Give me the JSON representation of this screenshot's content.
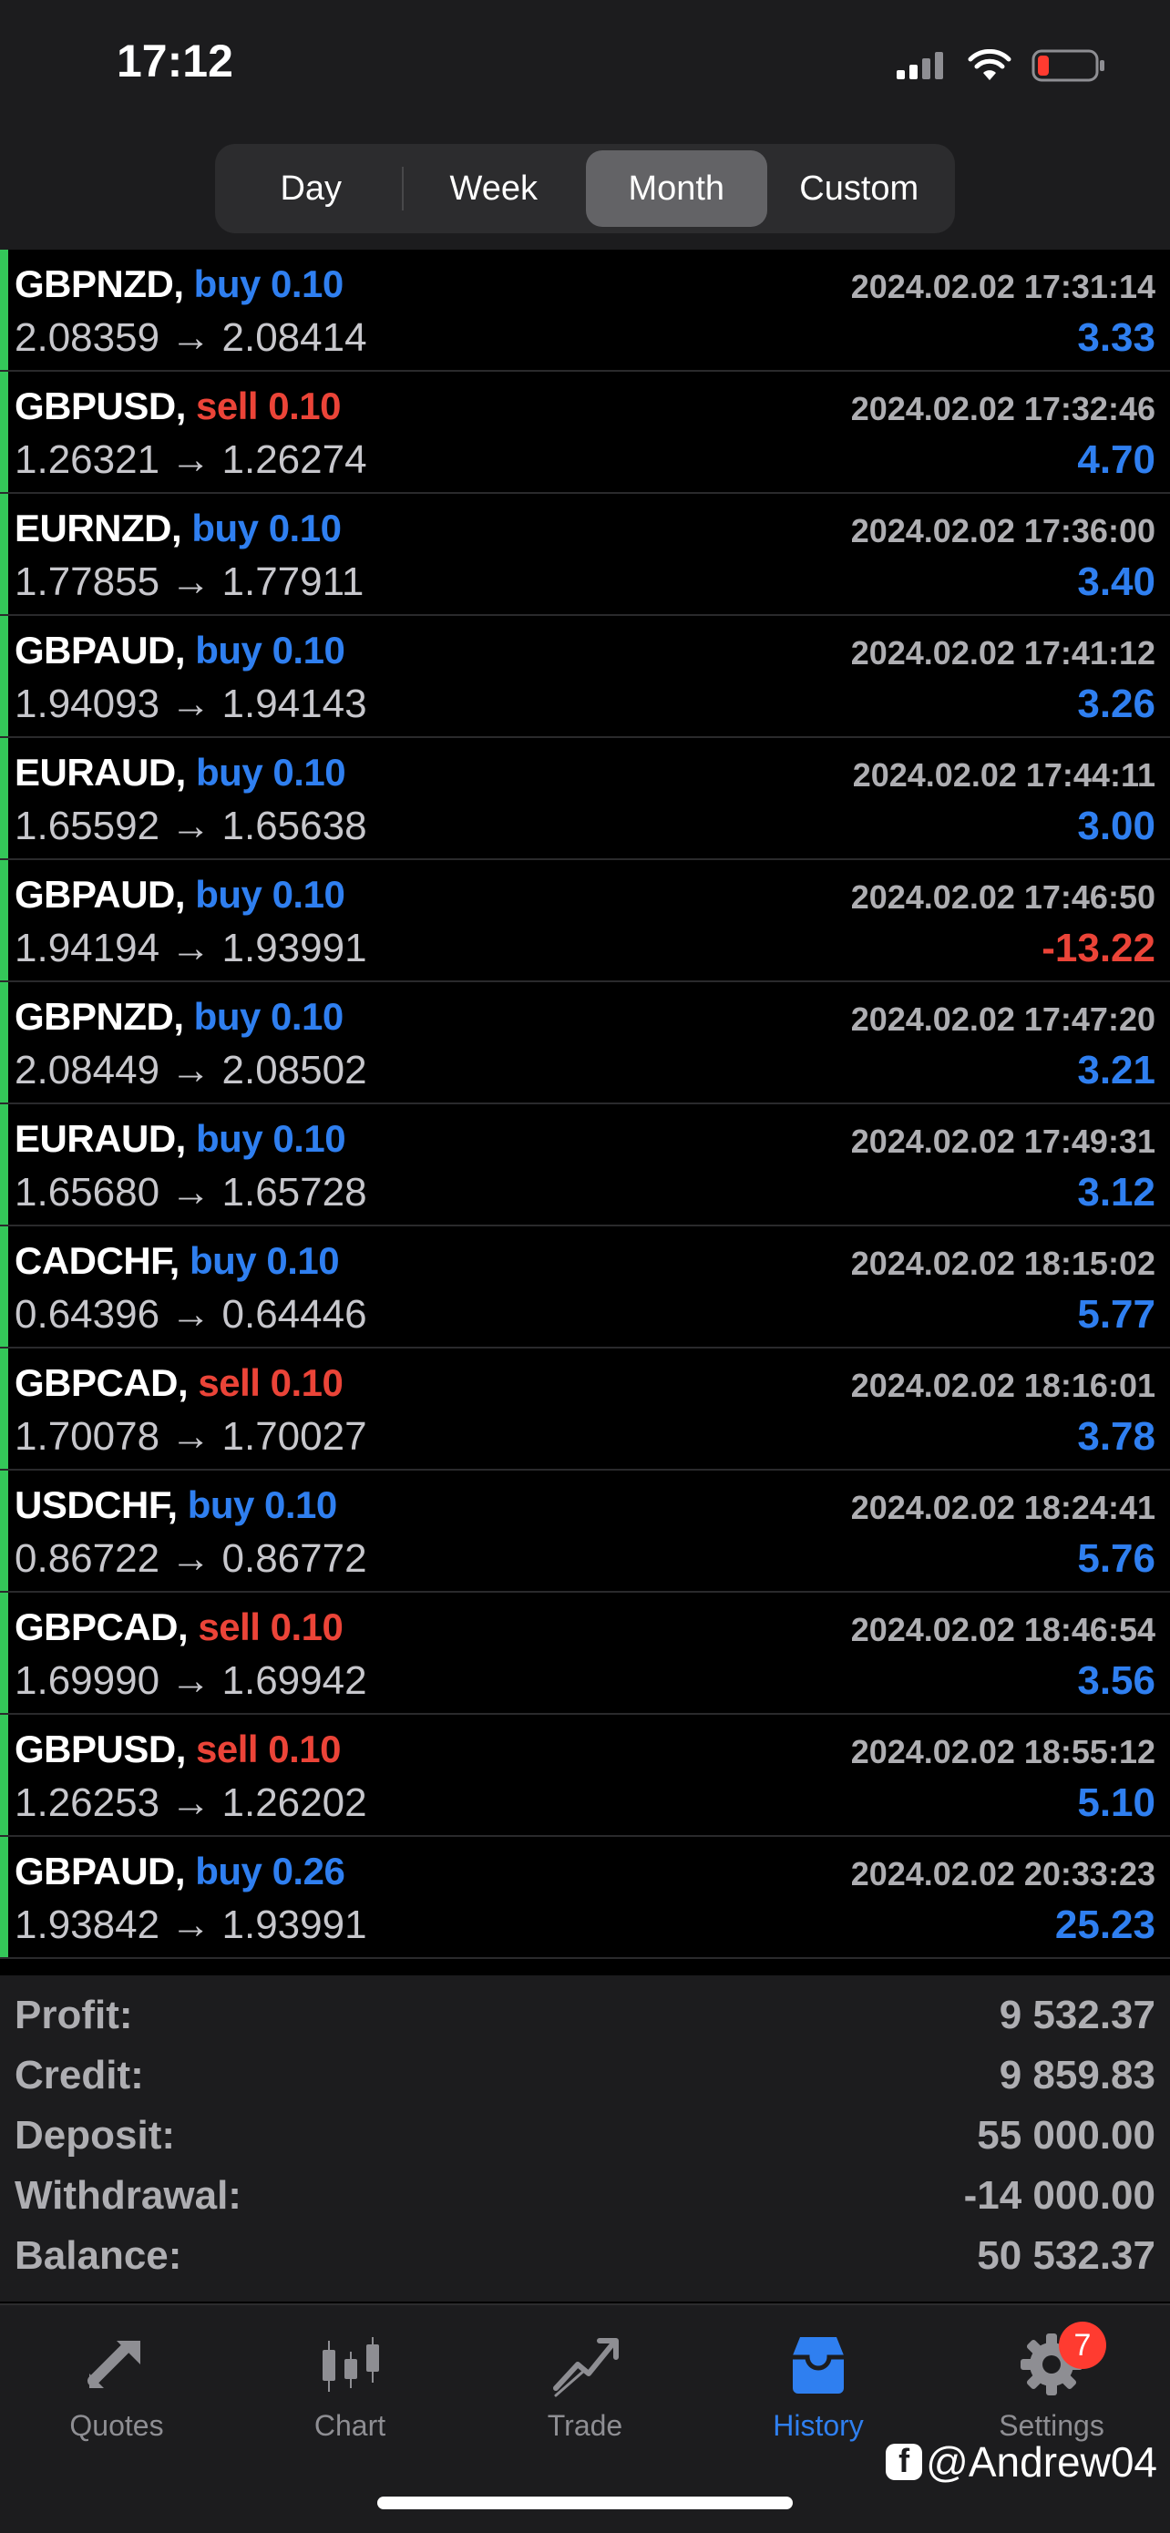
{
  "status": {
    "time": "17:12"
  },
  "period_tabs": [
    "Day",
    "Week",
    "Month",
    "Custom"
  ],
  "active_period": "Month",
  "trades": [
    {
      "symbol": "GBPNZD,",
      "side": "buy",
      "volume": "0.10",
      "open": "2.08359",
      "close": "2.08414",
      "time": "2024.02.02 17:31:14",
      "profit": "3.33"
    },
    {
      "symbol": "GBPUSD,",
      "side": "sell",
      "volume": "0.10",
      "open": "1.26321",
      "close": "1.26274",
      "time": "2024.02.02 17:32:46",
      "profit": "4.70"
    },
    {
      "symbol": "EURNZD,",
      "side": "buy",
      "volume": "0.10",
      "open": "1.77855",
      "close": "1.77911",
      "time": "2024.02.02 17:36:00",
      "profit": "3.40"
    },
    {
      "symbol": "GBPAUD,",
      "side": "buy",
      "volume": "0.10",
      "open": "1.94093",
      "close": "1.94143",
      "time": "2024.02.02 17:41:12",
      "profit": "3.26"
    },
    {
      "symbol": "EURAUD,",
      "side": "buy",
      "volume": "0.10",
      "open": "1.65592",
      "close": "1.65638",
      "time": "2024.02.02 17:44:11",
      "profit": "3.00"
    },
    {
      "symbol": "GBPAUD,",
      "side": "buy",
      "volume": "0.10",
      "open": "1.94194",
      "close": "1.93991",
      "time": "2024.02.02 17:46:50",
      "profit": "-13.22"
    },
    {
      "symbol": "GBPNZD,",
      "side": "buy",
      "volume": "0.10",
      "open": "2.08449",
      "close": "2.08502",
      "time": "2024.02.02 17:47:20",
      "profit": "3.21"
    },
    {
      "symbol": "EURAUD,",
      "side": "buy",
      "volume": "0.10",
      "open": "1.65680",
      "close": "1.65728",
      "time": "2024.02.02 17:49:31",
      "profit": "3.12"
    },
    {
      "symbol": "CADCHF,",
      "side": "buy",
      "volume": "0.10",
      "open": "0.64396",
      "close": "0.64446",
      "time": "2024.02.02 18:15:02",
      "profit": "5.77"
    },
    {
      "symbol": "GBPCAD,",
      "side": "sell",
      "volume": "0.10",
      "open": "1.70078",
      "close": "1.70027",
      "time": "2024.02.02 18:16:01",
      "profit": "3.78"
    },
    {
      "symbol": "USDCHF,",
      "side": "buy",
      "volume": "0.10",
      "open": "0.86722",
      "close": "0.86772",
      "time": "2024.02.02 18:24:41",
      "profit": "5.76"
    },
    {
      "symbol": "GBPCAD,",
      "side": "sell",
      "volume": "0.10",
      "open": "1.69990",
      "close": "1.69942",
      "time": "2024.02.02 18:46:54",
      "profit": "3.56"
    },
    {
      "symbol": "GBPUSD,",
      "side": "sell",
      "volume": "0.10",
      "open": "1.26253",
      "close": "1.26202",
      "time": "2024.02.02 18:55:12",
      "profit": "5.10"
    },
    {
      "symbol": "GBPAUD,",
      "side": "buy",
      "volume": "0.26",
      "open": "1.93842",
      "close": "1.93991",
      "time": "2024.02.02 20:33:23",
      "profit": "25.23"
    }
  ],
  "summary": [
    {
      "label": "Profit:",
      "value": "9 532.37"
    },
    {
      "label": "Credit:",
      "value": "9 859.83"
    },
    {
      "label": "Deposit:",
      "value": "55 000.00"
    },
    {
      "label": "Withdrawal:",
      "value": "-14 000.00"
    },
    {
      "label": "Balance:",
      "value": "50 532.37"
    }
  ],
  "tabbar": {
    "items": [
      {
        "label": "Quotes",
        "icon": "quotes-icon"
      },
      {
        "label": "Chart",
        "icon": "chart-icon"
      },
      {
        "label": "Trade",
        "icon": "trade-icon"
      },
      {
        "label": "History",
        "icon": "history-icon"
      },
      {
        "label": "Settings",
        "icon": "gear-icon"
      }
    ],
    "active": "History",
    "settings_badge": "7"
  },
  "watermark": "@Andrew04",
  "colors": {
    "buy": "#2f7ff0",
    "sell": "#eb4438",
    "positive": "#2f7ff0",
    "negative": "#eb4438",
    "row_bar": "#34c759",
    "badge": "#ff3b30"
  }
}
